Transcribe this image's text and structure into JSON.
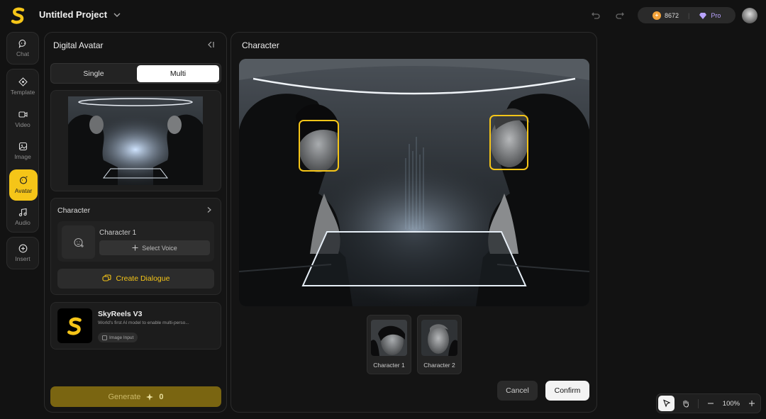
{
  "header": {
    "project_title": "Untitled Project",
    "credits": "8672",
    "plan": "Pro",
    "icons": [
      "logo-icon",
      "chevron-down-icon",
      "undo-icon",
      "redo-icon",
      "coin-icon",
      "diamond-icon",
      "avatar"
    ]
  },
  "rail": {
    "items": [
      {
        "label": "Chat",
        "icon": "chat-icon"
      },
      {
        "label": "Template",
        "icon": "template-icon"
      },
      {
        "label": "Video",
        "icon": "video-icon"
      },
      {
        "label": "Image",
        "icon": "image-icon"
      },
      {
        "label": "Avatar",
        "icon": "avatar-icon"
      },
      {
        "label": "Audio",
        "icon": "audio-icon"
      },
      {
        "label": "Insert",
        "icon": "plus-circle-icon"
      }
    ],
    "active": "Avatar"
  },
  "left_panel": {
    "title": "Digital Avatar",
    "mode_tabs": [
      "Single",
      "Multi"
    ],
    "active_mode": "Multi",
    "character_section": "Character",
    "character_name": "Character 1",
    "select_voice": "Select Voice",
    "create_dialogue": "Create Dialogue",
    "model": {
      "name": "SkyReels V3",
      "description": "World's first AI model to enable multi-perso...",
      "tag": "Image Input"
    },
    "generate_label": "Generate",
    "generate_cost": "0"
  },
  "main_panel": {
    "title": "Character",
    "characters": [
      "Character 1",
      "Character 2"
    ],
    "cancel": "Cancel",
    "confirm": "Confirm"
  },
  "zoom": {
    "level": "100%"
  },
  "colors": {
    "accent": "#f5c518",
    "background": "#121212",
    "panel": "#141414"
  }
}
